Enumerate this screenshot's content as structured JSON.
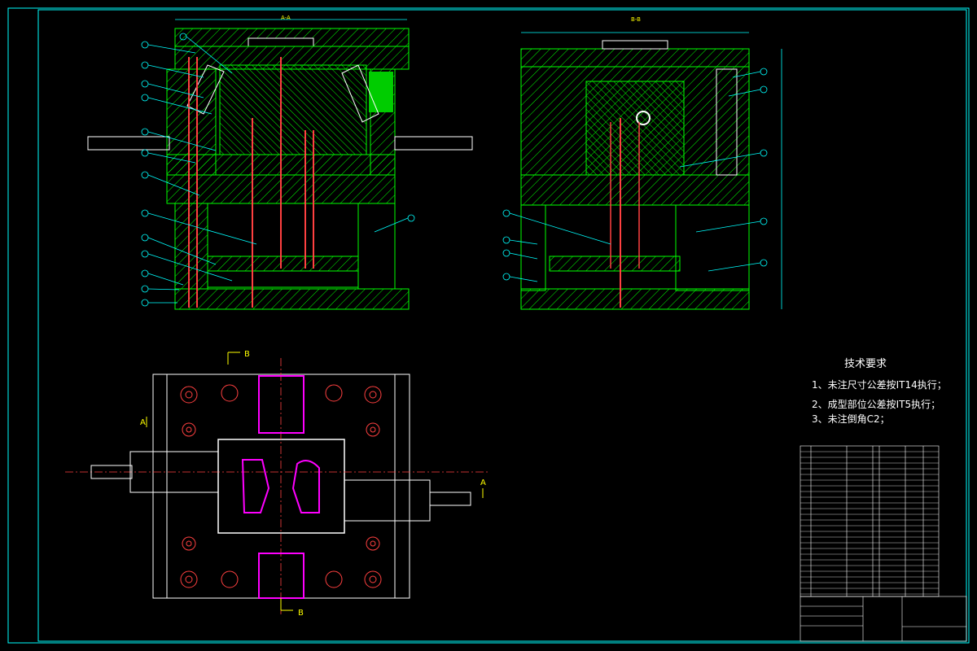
{
  "section_titles": {
    "a": "A-A",
    "b": "B-B"
  },
  "section_markers": {
    "a": "A",
    "b": "B"
  },
  "technical_requirements": {
    "title": "技术要求",
    "items": [
      "1、未注尺寸公差按IT14执行；",
      "2、成型部位公差按IT5执行；",
      "3、未注倒角C2；"
    ]
  },
  "colors": {
    "background": "#000000",
    "frame": "#00ffff",
    "hatch": "#00ff00",
    "cavity_fill": "#00cc00",
    "part": "#ff00ff",
    "pins": "#ff4040",
    "text": "#ffffff",
    "marker": "#ffff00"
  },
  "icons": [
    "balloon-callout",
    "section-arrow",
    "hatch-pattern"
  ]
}
